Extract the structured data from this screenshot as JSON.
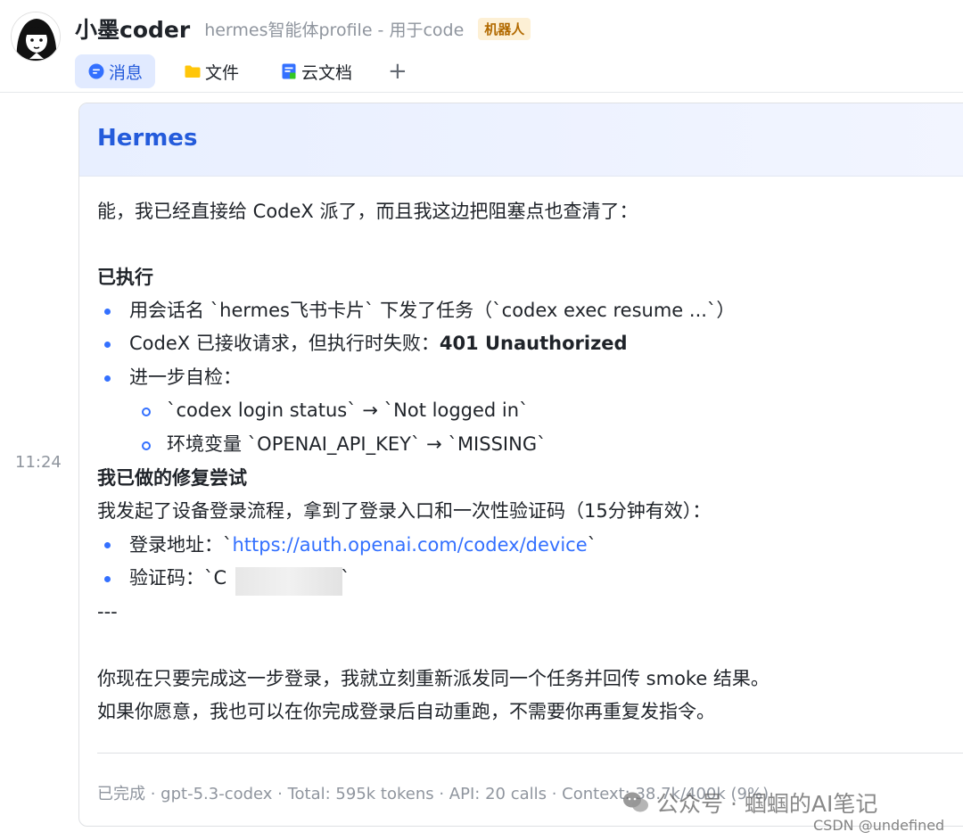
{
  "header": {
    "name": "小墨coder",
    "description": "hermes智能体profile - 用于code",
    "badge": "机器人",
    "tabs": [
      {
        "label": "消息",
        "icon": "chat-bubble-icon",
        "active": true
      },
      {
        "label": "文件",
        "icon": "folder-icon",
        "active": false
      },
      {
        "label": "云文档",
        "icon": "cloud-doc-icon",
        "active": false
      }
    ],
    "add_tab_icon": "plus-icon",
    "add_tab_label": "+"
  },
  "message": {
    "time": "11:24",
    "card_title": "Hermes",
    "intro": "能，我已经直接给 CodeX 派了，而且我这边把阻塞点也查清了：",
    "section1_title": "已执行",
    "section1_items": [
      "用会话名 `hermes飞书卡片` 下发了任务（`codex exec resume ...`）",
      "CodeX 已接收请求，但执行时失败：",
      "进一步自检："
    ],
    "section1_item2_bold": "401 Unauthorized",
    "section1_subitems": [
      "`codex login status` → `Not logged in`",
      "环境变量 `OPENAI_API_KEY` → `MISSING`"
    ],
    "section2_title": "我已做的修复尝试",
    "section2_intro": "我发起了设备登录流程，拿到了登录入口和一次性验证码（15分钟有效）：",
    "login_label": "登录地址：`",
    "login_url": "https://auth.openai.com/codex/device",
    "login_suffix": "`",
    "code_label": "验证码：`",
    "code_partial": "C",
    "code_suffix": "`",
    "separator": "---",
    "closing": [
      "你现在只要完成这一步登录，我就立刻重新派发同一个任务并回传 smoke 结果。",
      "如果你愿意，我也可以在你完成登录后自动重跑，不需要你再重复发指令。"
    ],
    "footer": "已完成 · gpt-5.3-codex · Total: 595k tokens · API: 20 calls · Context: 38.7k/400k (9%)"
  },
  "watermark": {
    "wechat": "公众号 · 蝈蝈的AI笔记",
    "csdn": "CSDN @undefined"
  },
  "colors": {
    "accent": "#3370ff",
    "title_blue": "#245bdb",
    "muted": "#8f959e"
  }
}
